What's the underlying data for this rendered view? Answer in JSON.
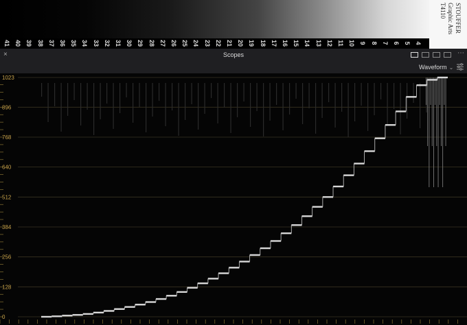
{
  "chart_target": {
    "step_numbers": [
      "41",
      "40",
      "39",
      "38",
      "37",
      "36",
      "35",
      "34",
      "33",
      "32",
      "31",
      "30",
      "29",
      "28",
      "27",
      "26",
      "25",
      "24",
      "23",
      "22",
      "21",
      "20",
      "19",
      "18",
      "17",
      "16",
      "15",
      "14",
      "13",
      "12",
      "11",
      "10",
      "9",
      "8",
      "7",
      "6",
      "5",
      "4"
    ],
    "brand_lines": [
      "STOUFFER",
      "Graphic Arts",
      "T4110"
    ]
  },
  "panel": {
    "title": "Scopes",
    "close_label": "×",
    "more_label": "⋯",
    "scope_type": "Waveform",
    "chevron": "⌄"
  },
  "chart_data": {
    "type": "line",
    "title": "",
    "ylabel": "",
    "ylim": [
      0,
      1023
    ],
    "y_ticks": [
      0,
      128,
      256,
      384,
      512,
      640,
      768,
      896,
      1023
    ],
    "grid": true,
    "series": [
      {
        "values": [
          0,
          2,
          5,
          8,
          12,
          18,
          25,
          33,
          42,
          52,
          63,
          76,
          90,
          106,
          124,
          143,
          163,
          186,
          210,
          236,
          264,
          293,
          324,
          357,
          392,
          430,
          470,
          512,
          557,
          605,
          655,
          708,
          763,
          820,
          878,
          940,
          990,
          1013,
          1023
        ]
      }
    ]
  }
}
